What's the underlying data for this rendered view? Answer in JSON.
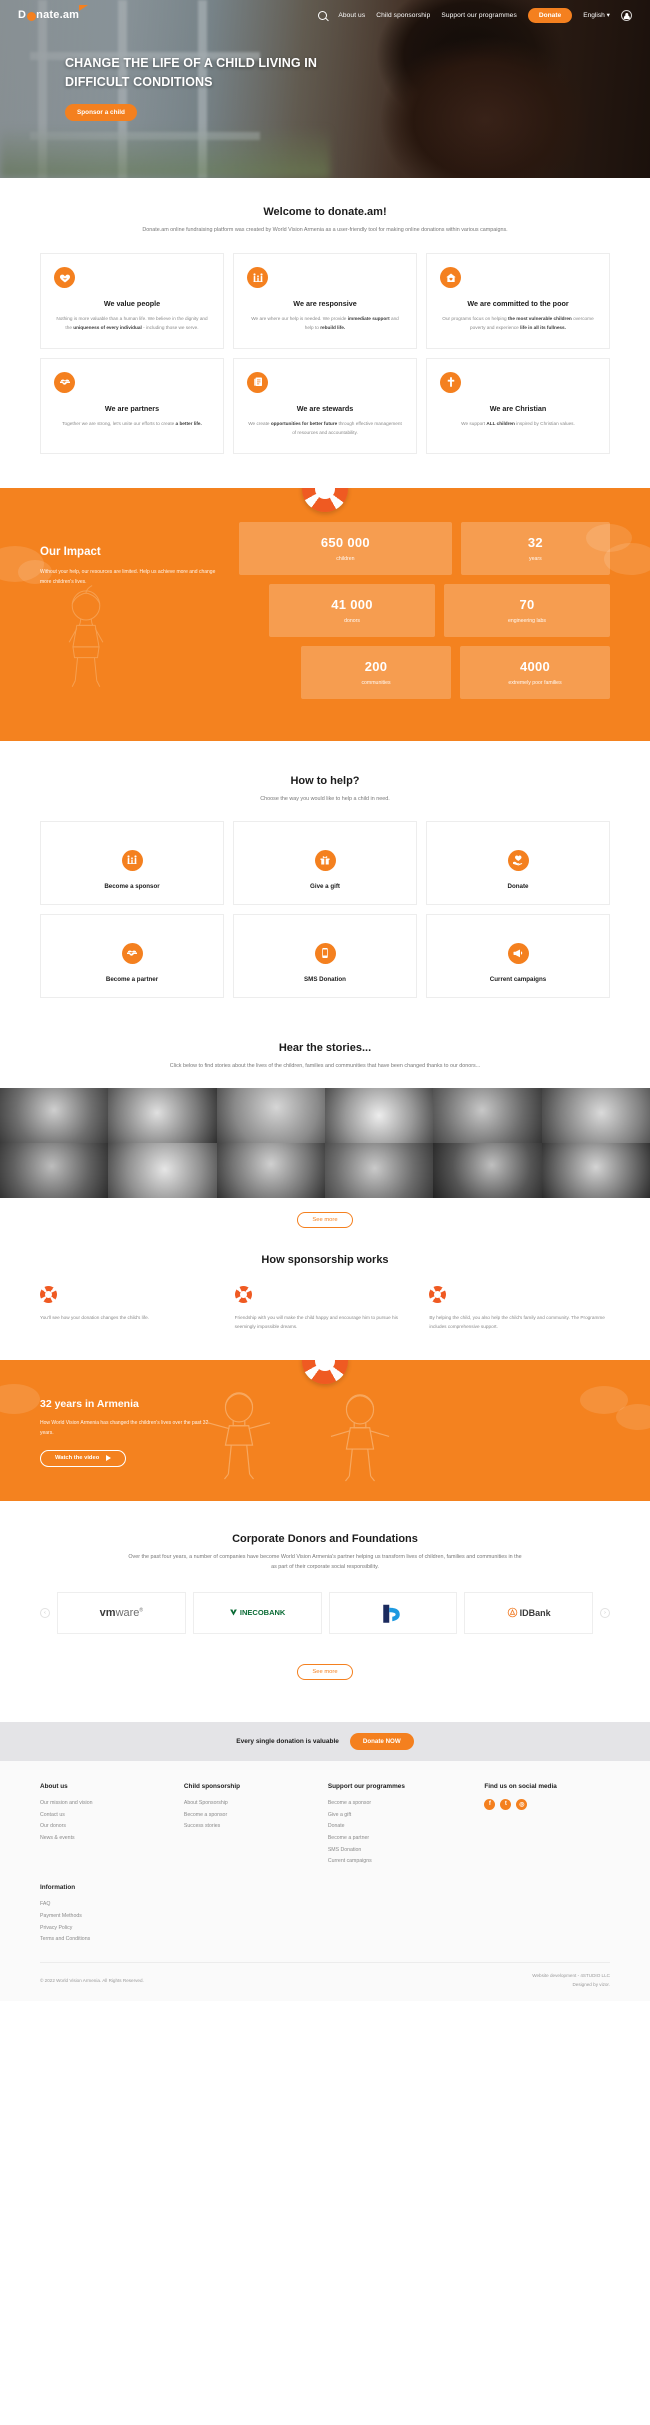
{
  "nav": {
    "logo_text_a": "D",
    "logo_text_b": "nate.am",
    "search_icon": "search-icon",
    "links": [
      "About us",
      "Child sponsorship",
      "Support our programmes"
    ],
    "donate_label": "Donate",
    "language": "English",
    "user_icon": "user-icon"
  },
  "hero": {
    "title": "CHANGE THE LIFE OF A CHILD LIVING IN DIFFICULT CONDITIONS",
    "cta": "Sponsor a child"
  },
  "welcome": {
    "title": "Welcome to donate.am!",
    "subtitle": "Donate.am online fundraising platform was created by World Vision Armenia as a user-friendly tool for making online donations within various campaigns.",
    "cards": [
      {
        "icon": "heart-hand-icon",
        "title": "We value people",
        "text_1": "Nothing is more valuable than a human life. We believe in the dignity and the ",
        "bold_1": "uniqueness of every individual",
        "text_2": " - including those we serve."
      },
      {
        "icon": "family-icon",
        "title": "We are responsive",
        "text_1": "We are where our help is needed. We provide ",
        "bold_1": "immediate support",
        "text_2": " and help to ",
        "bold_2": "rebuild life."
      },
      {
        "icon": "home-heart-icon",
        "title": "We are committed to the poor",
        "text_1": "Our programs focus on helping ",
        "bold_1": "the most vulnerable children",
        "text_2": " overcome poverty and experience ",
        "bold_2": "life in all its fullness."
      },
      {
        "icon": "handshake-icon",
        "title": "We are partners",
        "text_1": "Together we are strong, let's unite our efforts to create ",
        "bold_1": "a better life."
      },
      {
        "icon": "document-icon",
        "title": "We are stewards",
        "text_1": "We create ",
        "bold_1": "opportunities for better future",
        "text_2": " through effective management of resources and accountability."
      },
      {
        "icon": "cross-icon",
        "title": "We are Christian",
        "text_1": "We support ",
        "bold_1": "ALL children",
        "text_2": " inspired by Christian values."
      }
    ]
  },
  "impact": {
    "title": "Our Impact",
    "text": "Without your help, our resources are limited. Help us achieve more and change more children's lives.",
    "stats": [
      {
        "number": "650 000",
        "label": "children"
      },
      {
        "number": "32",
        "label": "years"
      },
      {
        "number": "41 000",
        "label": "donors"
      },
      {
        "number": "70",
        "label": "engineering labs"
      },
      {
        "number": "200",
        "label": "communities"
      },
      {
        "number": "4000",
        "label": "extremely poor families"
      }
    ]
  },
  "help": {
    "title": "How to help?",
    "subtitle": "Choose the way you would like to help a child in need.",
    "items": [
      {
        "icon": "family-icon",
        "label": "Become a sponsor"
      },
      {
        "icon": "gift-icon",
        "label": "Give a gift"
      },
      {
        "icon": "hand-heart-icon",
        "label": "Donate"
      },
      {
        "icon": "handshake-icon",
        "label": "Become a partner"
      },
      {
        "icon": "phone-icon",
        "label": "SMS Donation"
      },
      {
        "icon": "megaphone-icon",
        "label": "Current campaigns"
      }
    ]
  },
  "stories": {
    "title": "Hear the stories...",
    "subtitle": "Click below to find stories about the lives of the children, families and communities that have been changed thanks to our donors...",
    "see_more": "See more"
  },
  "sponsorship": {
    "title": "How sponsorship works",
    "steps": [
      {
        "icon": "lifebuoy-icon",
        "text": "You'll see how your donation changes the child's life."
      },
      {
        "icon": "lifebuoy-icon",
        "text": "Friendship with you will make the child happy and encourage him to pursue his seemingly impossible dreams."
      },
      {
        "icon": "lifebuoy-icon",
        "text": "By helping the child, you also help the child's family and community. The Programme includes comprehensive support."
      }
    ]
  },
  "years_banner": {
    "title": "32 years in Armenia",
    "text": "How World Vision Armenia has changed the children's lives over the past 32 years.",
    "button": "Watch the video"
  },
  "donors": {
    "title": "Corporate Donors and Foundations",
    "subtitle": "Over the past four years, a number of companies have become World Vision Armenia's partner helping us transform lives of children, families and communities in the as part of their corporate social responsibility.",
    "prev_icon": "chevron-left-icon",
    "next_icon": "chevron-right-icon",
    "logos": [
      "vmware",
      "INECOBANK",
      "Ameriabank",
      "IDBank"
    ],
    "see_more": "See more"
  },
  "cta_strip": {
    "text": "Every single donation is valuable",
    "button": "Donate NOW"
  },
  "footer": {
    "columns": [
      {
        "title": "About us",
        "links": [
          "Our mission and vision",
          "Contact us",
          "Our donors",
          "News & events"
        ]
      },
      {
        "title": "Child sponsorship",
        "links": [
          "About Sponsorship",
          "Become a sponsor",
          "Success stories"
        ]
      },
      {
        "title": "Support our programmes",
        "links": [
          "Become a sponsor",
          "Give a gift",
          "Donate",
          "Become a partner",
          "SMS Donation",
          "Current campaigns"
        ]
      }
    ],
    "social": {
      "title": "Find us on social media",
      "icons": [
        "facebook-icon",
        "twitter-icon",
        "instagram-icon"
      ]
    },
    "information": {
      "title": "Information",
      "links": [
        "FAQ",
        "Payment Methods",
        "Privacy Policy",
        "Terms and Conditions"
      ]
    },
    "copyright": "© 2022 World Vision Armenia. All Rights Reserved.",
    "dev_line_1": "Website development - 4STUDIO LLC",
    "dev_line_2": "Designed by vizor."
  }
}
